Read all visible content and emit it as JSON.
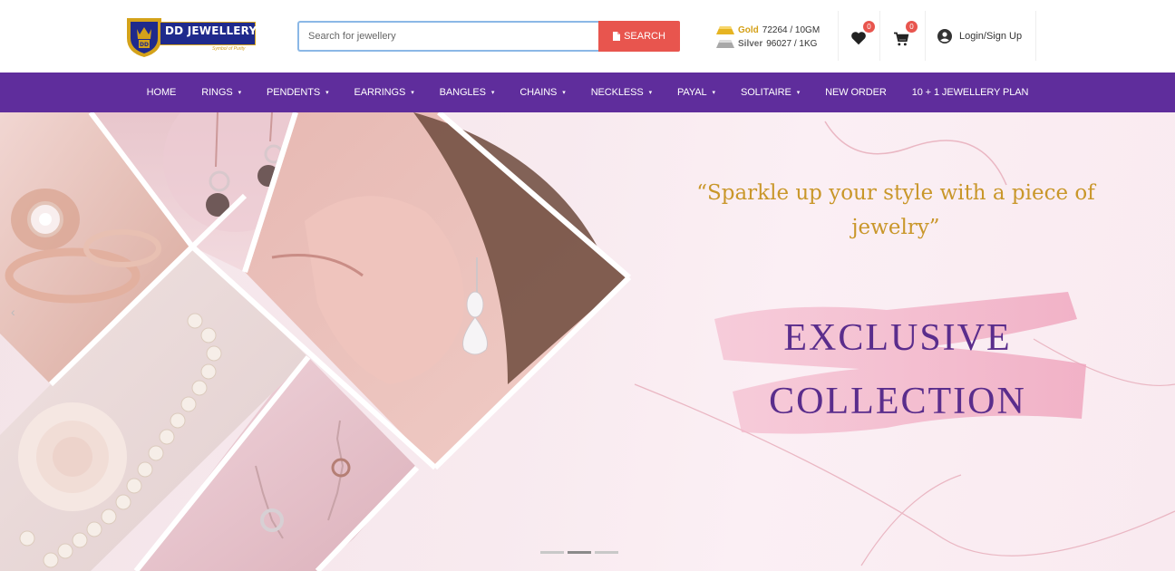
{
  "brand": {
    "name": "DD JEWELLERY",
    "tagline": "Symbol of Purity"
  },
  "search": {
    "placeholder": "Search for jewellery",
    "button_label": "SEARCH"
  },
  "rates": {
    "gold": {
      "label": "Gold",
      "value": "72264 / 10GM"
    },
    "silver": {
      "label": "Silver",
      "value": "96027 / 1KG"
    }
  },
  "wishlist": {
    "count": "0"
  },
  "cart": {
    "count": "0"
  },
  "account": {
    "label": "Login/Sign Up"
  },
  "nav": {
    "items": [
      {
        "label": "HOME",
        "dropdown": false
      },
      {
        "label": "RINGS",
        "dropdown": true
      },
      {
        "label": "PENDENTS",
        "dropdown": true
      },
      {
        "label": "EARRINGS",
        "dropdown": true
      },
      {
        "label": "BANGLES",
        "dropdown": true
      },
      {
        "label": "CHAINS",
        "dropdown": true
      },
      {
        "label": "NECKLESS",
        "dropdown": true
      },
      {
        "label": "PAYAL",
        "dropdown": true
      },
      {
        "label": "SOLITAIRE",
        "dropdown": true
      },
      {
        "label": "NEW ORDER",
        "dropdown": false
      },
      {
        "label": "10 + 1 JEWELLERY PLAN",
        "dropdown": false
      }
    ],
    "caret": "▾"
  },
  "hero": {
    "quote_line1": "“Sparkle up your style with a piece of",
    "quote_line2": "jewelry”",
    "headline_line1": "EXCLUSIVE",
    "headline_line2": "COLLECTION",
    "prev_arrow": "‹",
    "slides": 3,
    "active_slide": 1
  },
  "colors": {
    "nav_bg": "#5f2d9c",
    "search_button": "#e8554e",
    "headline": "#5a2d8c",
    "quote": "#c9972a",
    "gold": "#d4a017"
  }
}
